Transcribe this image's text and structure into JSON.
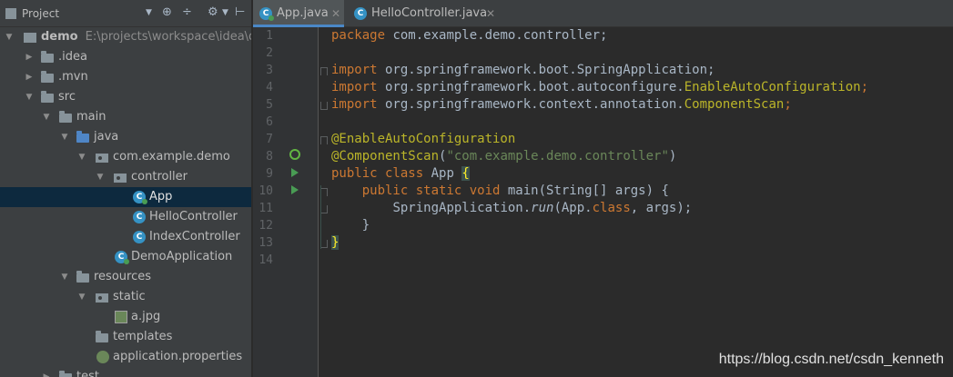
{
  "project_panel": {
    "title": "Project",
    "tree": [
      {
        "label": "demo",
        "path": "E:\\projects\\workspace\\idea\\de",
        "bold": true
      },
      {
        "label": ".idea"
      },
      {
        "label": ".mvn"
      },
      {
        "label": "src"
      },
      {
        "label": "main"
      },
      {
        "label": "java"
      },
      {
        "label": "com.example.demo"
      },
      {
        "label": "controller"
      },
      {
        "label": "App"
      },
      {
        "label": "HelloController"
      },
      {
        "label": "IndexController"
      },
      {
        "label": "DemoApplication"
      },
      {
        "label": "resources"
      },
      {
        "label": "static"
      },
      {
        "label": "a.jpg"
      },
      {
        "label": "templates"
      },
      {
        "label": "application.properties"
      },
      {
        "label": "test"
      }
    ]
  },
  "tabs": [
    {
      "label": "App.java",
      "active": true
    },
    {
      "label": "HelloController.java",
      "active": false
    }
  ],
  "editor": {
    "line_numbers": [
      "1",
      "2",
      "3",
      "4",
      "5",
      "6",
      "7",
      "8",
      "9",
      "10",
      "11",
      "12",
      "13",
      "14"
    ],
    "code": {
      "l1_kw": "package",
      "l1_rest": " com.example.demo.controller;",
      "l3_kw": "import",
      "l3_rest": " org.springframework.boot.SpringApplication;",
      "l4_kw": "import",
      "l4_pre": " org.springframework.boot.autoconfigure.",
      "l4_ann": "EnableAutoConfiguration",
      "l4_end": ";",
      "l5_kw": "import",
      "l5_pre": " org.springframework.context.annotation.",
      "l5_ann": "ComponentScan",
      "l5_end": ";",
      "l7_ann": "@EnableAutoConfiguration",
      "l8_ann": "@ComponentScan",
      "l8_open": "(",
      "l8_str": "\"com.example.demo.controller\"",
      "l8_close": ")",
      "l9_kw": "public class",
      "l9_name": " App ",
      "l9_brace": "{",
      "l10_indent": "    ",
      "l10_kw": "public static void",
      "l10_rest": " main(String[] args) {",
      "l11_indent": "        ",
      "l11_pre": "SpringApplication.",
      "l11_run": "run",
      "l11_mid": "(App.",
      "l11_kw": "class",
      "l11_end": ", args);",
      "l12": "    }",
      "l13_brace": "}"
    }
  },
  "watermark": "https://blog.csdn.net/csdn_kenneth",
  "colors": {
    "keyword": "#cc7832",
    "annotation": "#bbb529",
    "string": "#6a8759",
    "selection": "#0d293e"
  }
}
